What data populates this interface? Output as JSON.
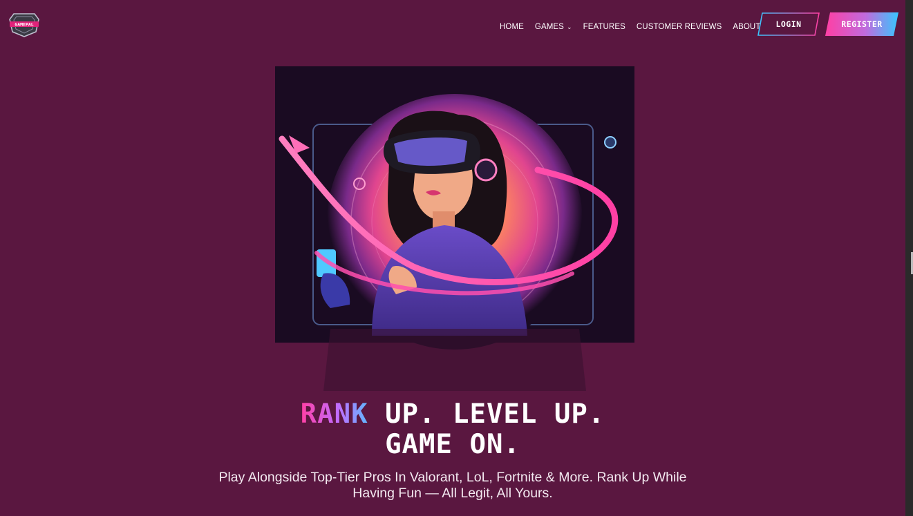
{
  "brand": {
    "logo_text": "GAMEPAL"
  },
  "nav": {
    "items": [
      {
        "label": "HOME"
      },
      {
        "label": "GAMES",
        "has_dropdown": true
      },
      {
        "label": "FEATURES"
      },
      {
        "label": "CUSTOMER REVIEWS"
      },
      {
        "label": "ABOUT"
      }
    ]
  },
  "auth": {
    "login_label": "LOGIN",
    "register_label": "REGISTER"
  },
  "hero": {
    "headline_accent": "RANK",
    "headline_rest": " UP. LEVEL UP.",
    "headline_line2": "GAME ON.",
    "subtitle": "Play Alongside Top-Tier Pros In Valorant, LoL, Fortnite & More. Rank Up While Having Fun — All Legit, All Yours."
  },
  "colors": {
    "background": "#5a1740",
    "accent_pink": "#ff3fa4",
    "accent_blue": "#5fb8ff",
    "register_gradient": [
      "#ff3fa4",
      "#38c6ff"
    ]
  },
  "icons": {
    "logo": "shield-logo-icon",
    "dropdown": "chevron-down-icon"
  }
}
